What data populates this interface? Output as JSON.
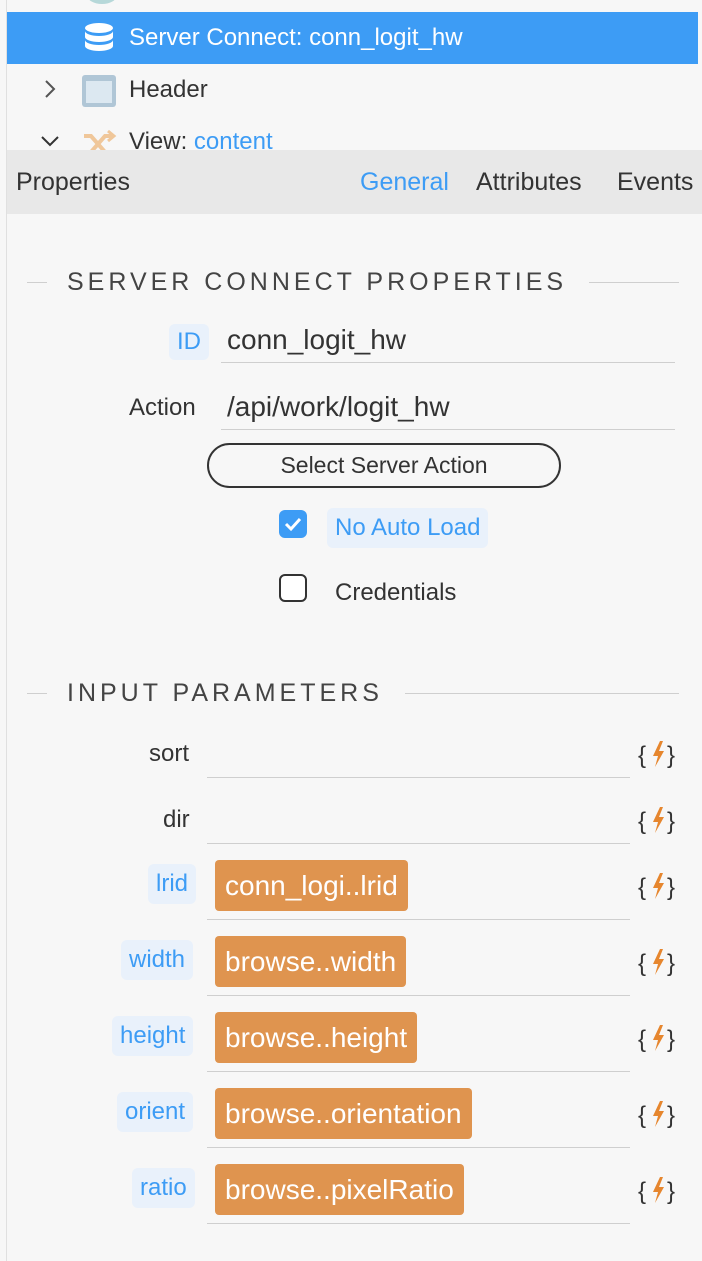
{
  "tree": {
    "items": [
      {
        "label": "Server Connect: conn_logit_hw",
        "selected": true,
        "icon": "database-icon"
      },
      {
        "label": "Header",
        "icon": "header-block-icon",
        "expanded": false
      },
      {
        "label_prefix": "View: ",
        "label_link": "content",
        "icon": "shuffle-route-icon",
        "expanded": true
      }
    ]
  },
  "properties": {
    "title": "Properties",
    "tabs": [
      {
        "label": "General",
        "active": true
      },
      {
        "label": "Attributes",
        "active": false
      },
      {
        "label": "Events",
        "active": false
      }
    ]
  },
  "server_connect": {
    "heading": "SERVER CONNECT PROPERTIES",
    "id_label": "ID",
    "id_value": "conn_logit_hw",
    "action_label": "Action",
    "action_value": "/api/work/logit_hw",
    "select_button": "Select Server Action",
    "no_auto_load_label": "No Auto Load",
    "no_auto_load_checked": true,
    "credentials_label": "Credentials",
    "credentials_checked": false
  },
  "input_parameters": {
    "heading": "INPUT PARAMETERS",
    "dynamic_icon": "{⚡}",
    "params": [
      {
        "label": "sort",
        "value": ""
      },
      {
        "label": "dir",
        "value": ""
      },
      {
        "label": "lrid",
        "value": "conn_logi..lrid"
      },
      {
        "label": "width",
        "value": "browse..width"
      },
      {
        "label": "height",
        "value": "browse..height"
      },
      {
        "label": "orient",
        "value": "browse..orientation"
      },
      {
        "label": "ratio",
        "value": "browse..pixelRatio"
      }
    ]
  },
  "colors": {
    "accent": "#3d9cf5",
    "selected_bg": "#3d9cf5",
    "binding_pill": "#df944f",
    "lightning": "#e6862e"
  }
}
